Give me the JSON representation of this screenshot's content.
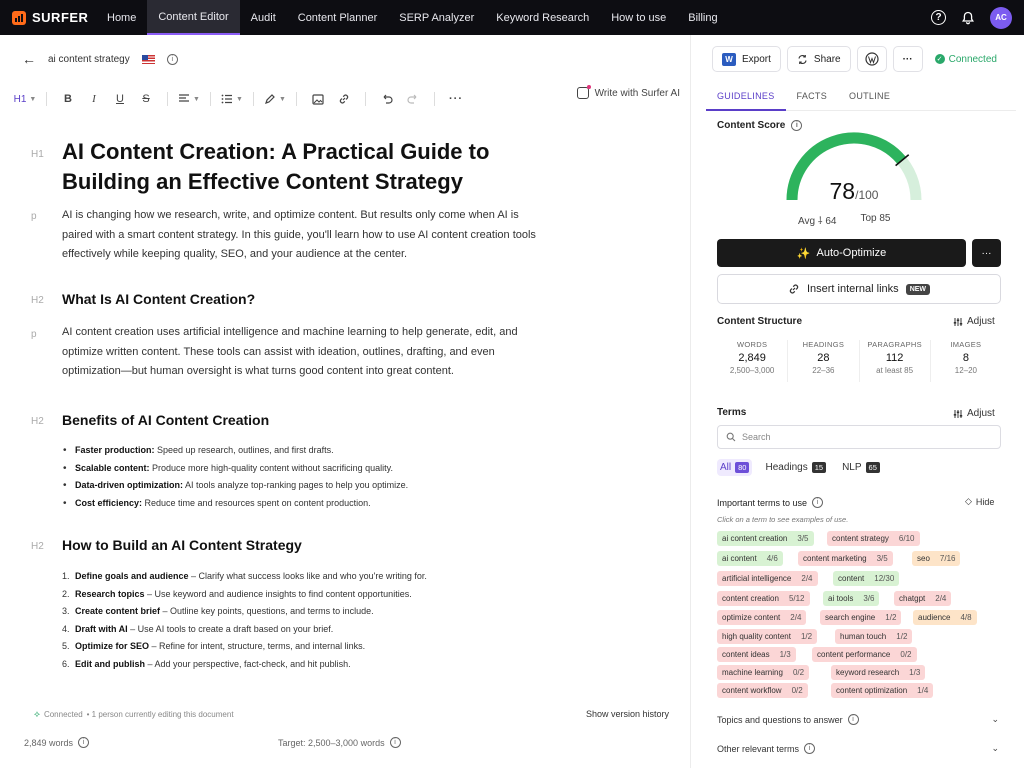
{
  "nav": {
    "logo": "SURFER",
    "items": [
      "Home",
      "Content Editor",
      "Audit",
      "Content Planner",
      "SERP Analyzer",
      "Keyword Research",
      "How to use",
      "Billing"
    ],
    "avatar": "AC"
  },
  "doc": {
    "title": "ai content strategy"
  },
  "toolbar": {
    "heading": "H1",
    "write_with_surfer": "Write with Surfer AI"
  },
  "content": {
    "gutter_h1": "H1",
    "gutter_p": "p",
    "gutter_h2": "H2",
    "h1": "AI Content Creation: A Practical Guide to Building an Effective Content Strategy",
    "intro": "AI is changing how we research, write, and optimize content. But results only come when AI is paired with a smart content strategy. In this guide, you'll learn how to use AI content creation tools effectively while keeping quality, SEO, and your audience at the center.",
    "h2_what": "What Is AI Content Creation?",
    "what_para": "AI content creation uses artificial intelligence and machine learning to help generate, edit, and optimize written content. These tools can assist with ideation, outlines, drafting, and even optimization—but human oversight is what turns good content into great content.",
    "h2_benefits": "Benefits of AI Content Creation",
    "benefits": [
      {
        "bold": "Faster production:",
        "text": " Speed up research, outlines, and first drafts."
      },
      {
        "bold": "Scalable content:",
        "text": " Produce more high-quality content without sacrificing quality."
      },
      {
        "bold": "Data-driven optimization:",
        "text": " AI tools analyze top-ranking pages to help you optimize."
      },
      {
        "bold": "Cost efficiency:",
        "text": " Reduce time and resources spent on content production."
      }
    ],
    "h2_how": "How to Build an AI Content Strategy",
    "steps": [
      {
        "num": "1.",
        "bold": "Define goals and audience",
        "text": " – Clarify what success looks like and who you're writing for."
      },
      {
        "num": "2.",
        "bold": "Research topics",
        "text": " – Use keyword and audience insights to find content opportunities."
      },
      {
        "num": "3.",
        "bold": "Create content brief",
        "text": " – Outline key points, questions, and terms to include."
      },
      {
        "num": "4.",
        "bold": "Draft with AI",
        "text": " – Use AI tools to create a draft based on your brief."
      },
      {
        "num": "5.",
        "bold": "Optimize for SEO",
        "text": " – Refine for intent, structure, terms, and internal links."
      },
      {
        "num": "6.",
        "bold": "Edit and publish",
        "text": " – Add your perspective, fact-check, and hit publish."
      }
    ]
  },
  "footer": {
    "status": "Connected",
    "editing": "• 1 person currently editing this document",
    "version_history": "Show version history",
    "word_count": "2,849 words",
    "target": "Target: 2,500–3,000 words"
  },
  "right": {
    "export": "Export",
    "share": "Share",
    "more": "···",
    "connected": "Connected",
    "tabs": [
      "GUIDELINES",
      "FACTS",
      "OUTLINE"
    ],
    "content_score_label": "Content Score",
    "score": "78",
    "score_max": "/100",
    "score_value": 78,
    "avg": "Avg",
    "avg_value": "64",
    "top": "Top 85",
    "auto_optimize": "Auto-Optimize",
    "insert_links": "Insert internal links",
    "new_badge": "NEW",
    "structure_label": "Content Structure",
    "adjust": "Adjust",
    "stats": [
      {
        "label": "WORDS",
        "value": "2,849",
        "range": "2,500–3,000"
      },
      {
        "label": "HEADINGS",
        "value": "28",
        "range": "22–36"
      },
      {
        "label": "PARAGRAPHS",
        "value": "112",
        "range": "at least 85"
      },
      {
        "label": "IMAGES",
        "value": "8",
        "range": "12–20"
      }
    ],
    "terms_label": "Terms",
    "search_placeholder": "Search",
    "filters": [
      {
        "label": "All",
        "count": "80"
      },
      {
        "label": "Headings",
        "count": "15"
      },
      {
        "label": "NLP",
        "count": "65"
      }
    ],
    "important_label": "Important terms to use",
    "hide": "Hide",
    "hint": "Click on a term to see examples of use.",
    "terms": [
      {
        "term": "ai content creation",
        "count": "3/5",
        "color": "green"
      },
      {
        "term": "content strategy",
        "count": "6/10",
        "color": "red"
      },
      {
        "term": "ai content",
        "count": "4/6",
        "color": "green"
      },
      {
        "term": "content marketing",
        "count": "3/5",
        "color": "red"
      },
      {
        "term": "seo",
        "count": "7/16",
        "color": "orange"
      },
      {
        "term": "artificial intelligence",
        "count": "2/4",
        "color": "red"
      },
      {
        "term": "content",
        "count": "12/30",
        "color": "green"
      },
      {
        "term": "content creation",
        "count": "5/12",
        "color": "red"
      },
      {
        "term": "ai tools",
        "count": "3/6",
        "color": "green"
      },
      {
        "term": "chatgpt",
        "count": "2/4",
        "color": "red"
      },
      {
        "term": "optimize content",
        "count": "2/4",
        "color": "red"
      },
      {
        "term": "search engine",
        "count": "1/2",
        "color": "red"
      },
      {
        "term": "audience",
        "count": "4/8",
        "color": "orange"
      },
      {
        "term": "high quality content",
        "count": "1/2",
        "color": "red"
      },
      {
        "term": "human touch",
        "count": "1/2",
        "color": "red"
      },
      {
        "term": "content ideas",
        "count": "1/3",
        "color": "red"
      },
      {
        "term": "content performance",
        "count": "0/2",
        "color": "red"
      },
      {
        "term": "machine learning",
        "count": "0/2",
        "color": "red"
      },
      {
        "term": "keyword research",
        "count": "1/3",
        "color": "red"
      },
      {
        "term": "content workflow",
        "count": "0/2",
        "color": "red"
      },
      {
        "term": "content optimization",
        "count": "1/4",
        "color": "red"
      }
    ],
    "topics_label": "Topics and questions to answer",
    "other_terms_label": "Other relevant terms"
  },
  "colors": {
    "accent": "#5a3ec8",
    "gauge_green": "#2db35d",
    "gauge_gray": "#d6efdc",
    "nav_bg": "#0d0d12"
  }
}
